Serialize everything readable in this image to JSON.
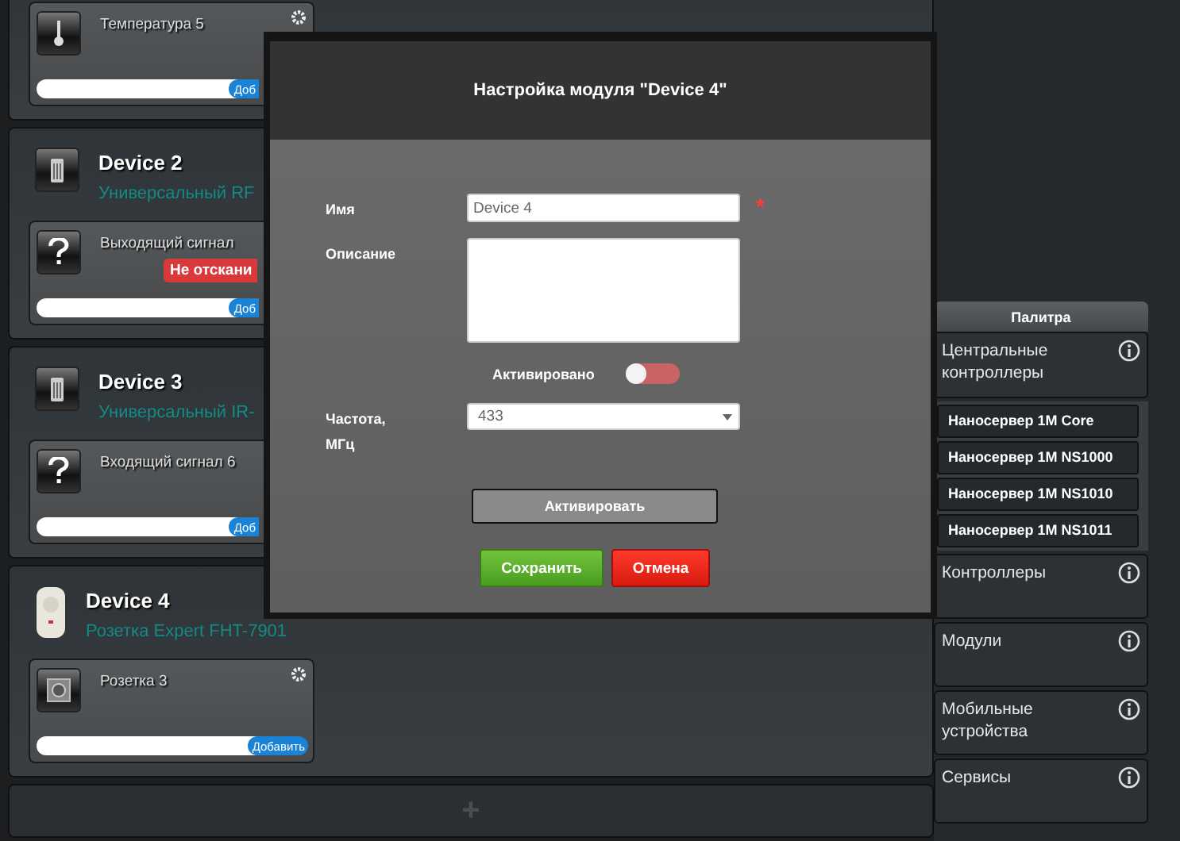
{
  "panels": [
    {
      "modules": [
        {
          "kind": "thermometer",
          "title": "Температура 5",
          "settings_icon": true,
          "button": "Доб",
          "button_cut": true
        }
      ]
    },
    {
      "device": {
        "kind": "remote",
        "name": "Device 2",
        "model": "Универсальный RF"
      },
      "modules": [
        {
          "kind": "question",
          "title": "Выходящий сигнал",
          "settings_icon": false,
          "badge": "Не отскани",
          "button": "Доб",
          "button_cut": true
        }
      ]
    },
    {
      "device": {
        "kind": "remote",
        "name": "Device 3",
        "model": "Универсальный IR-"
      },
      "modules": [
        {
          "kind": "question",
          "title": "Входящий сигнал 6",
          "settings_icon": false,
          "button": "Доб",
          "button_cut": true
        }
      ]
    },
    {
      "device": {
        "kind": "socket",
        "name": "Device 4",
        "model": "Розетка Expert FHT-7901"
      },
      "modules": [
        {
          "kind": "socket",
          "title": "Розетка 3",
          "settings_icon": true,
          "button": "Добавить",
          "button_cut": false
        }
      ]
    }
  ],
  "add_panel": {
    "label": "+"
  },
  "dialog": {
    "title": "Настройка модуля \"Device 4\"",
    "name": {
      "label": "Имя",
      "value": "Device 4",
      "required": "*"
    },
    "description": {
      "label": "Описание"
    },
    "activated": {
      "label": "Активировано",
      "on": false
    },
    "frequency": {
      "label": "Частота, МГц",
      "value": "433"
    },
    "activate_button": "Активировать",
    "save_button": "Сохранить",
    "cancel_button": "Отмена"
  },
  "palette": {
    "title": "Палитра",
    "groups": [
      {
        "label": "Центральные контроллеры",
        "expanded": true,
        "items": [
          "Наносервер 1M Core",
          "Наносервер 1M NS1000",
          "Наносервер 1M NS1010",
          "Наносервер 1M NS1011"
        ]
      },
      {
        "label": "Контроллеры",
        "expanded": false
      },
      {
        "label": "Модули",
        "expanded": false
      },
      {
        "label": "Мобильные устройства",
        "expanded": false
      },
      {
        "label": "Сервисы",
        "expanded": false
      }
    ]
  }
}
